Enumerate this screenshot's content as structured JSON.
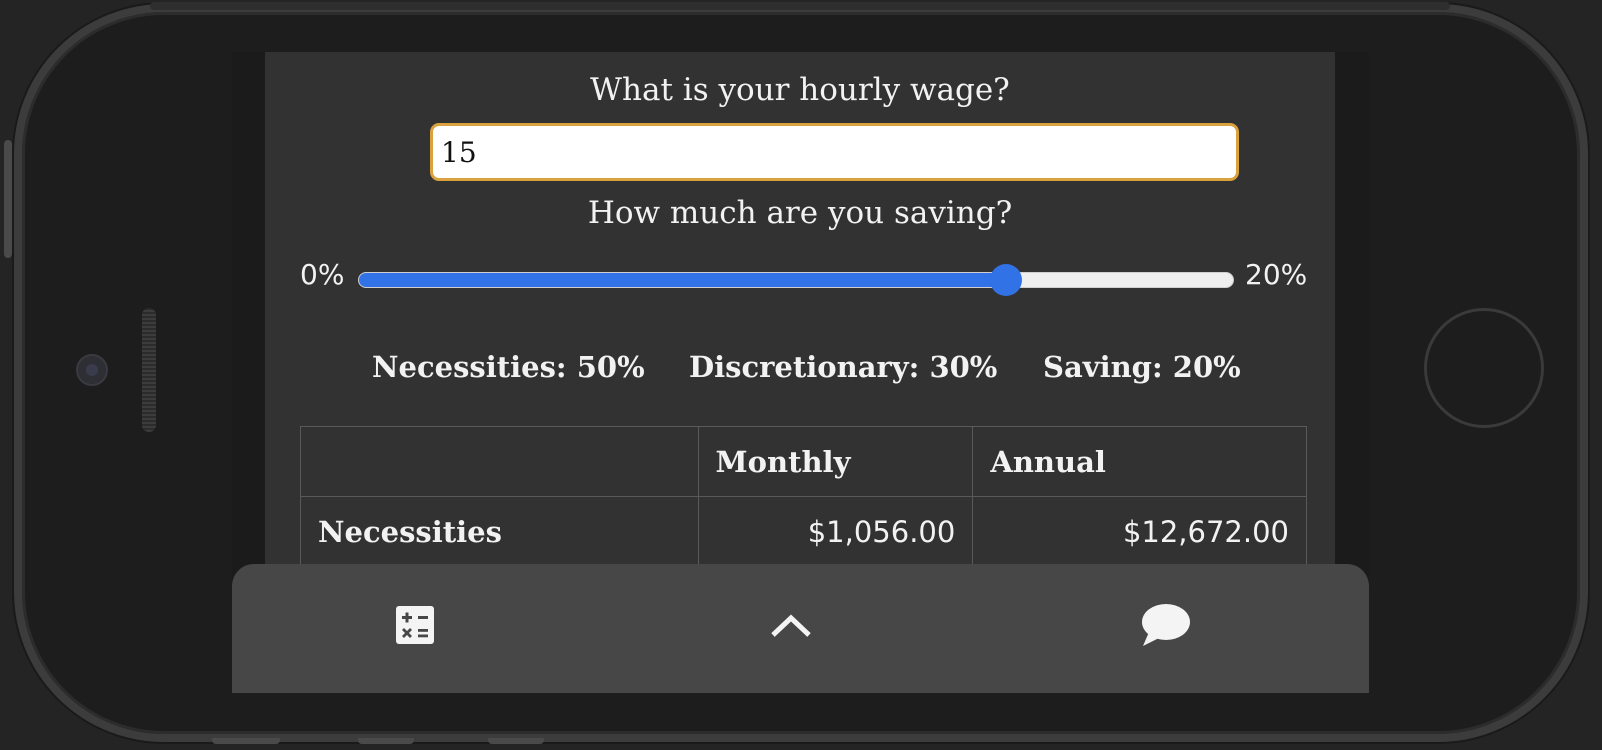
{
  "form": {
    "wage_question": "What is your hourly wage?",
    "wage_value": "15",
    "saving_question": "How much are you saving?"
  },
  "slider": {
    "min_label": "0%",
    "max_label": "20%",
    "value_fraction": 0.74
  },
  "split": {
    "necessities": "Necessities: 50%",
    "discretionary": "Discretionary: 30%",
    "saving": "Saving: 20%"
  },
  "table": {
    "headers": [
      "",
      "Monthly",
      "Annual"
    ],
    "rows": [
      {
        "label": "Necessities",
        "monthly": "$1,056.00",
        "annual": "$12,672.00"
      }
    ]
  },
  "bottom_bar": {
    "icons": [
      "calculator-icon",
      "chevron-up-icon",
      "chat-bubble-icon"
    ]
  },
  "colors": {
    "accent_blue": "#3172e6",
    "input_border": "#d9a23f",
    "panel_bg": "#323232",
    "bar_bg": "#474747"
  }
}
